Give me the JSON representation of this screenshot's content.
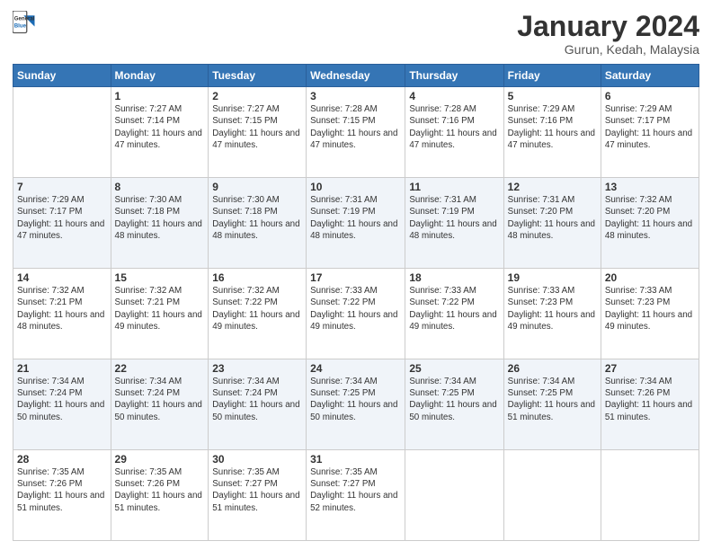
{
  "header": {
    "logo": {
      "general": "General",
      "blue": "Blue"
    },
    "title": "January 2024",
    "location": "Gurun, Kedah, Malaysia"
  },
  "columns": [
    "Sunday",
    "Monday",
    "Tuesday",
    "Wednesday",
    "Thursday",
    "Friday",
    "Saturday"
  ],
  "weeks": [
    [
      {
        "day": "",
        "sunrise": "",
        "sunset": "",
        "daylight": ""
      },
      {
        "day": "1",
        "sunrise": "Sunrise: 7:27 AM",
        "sunset": "Sunset: 7:14 PM",
        "daylight": "Daylight: 11 hours and 47 minutes."
      },
      {
        "day": "2",
        "sunrise": "Sunrise: 7:27 AM",
        "sunset": "Sunset: 7:15 PM",
        "daylight": "Daylight: 11 hours and 47 minutes."
      },
      {
        "day": "3",
        "sunrise": "Sunrise: 7:28 AM",
        "sunset": "Sunset: 7:15 PM",
        "daylight": "Daylight: 11 hours and 47 minutes."
      },
      {
        "day": "4",
        "sunrise": "Sunrise: 7:28 AM",
        "sunset": "Sunset: 7:16 PM",
        "daylight": "Daylight: 11 hours and 47 minutes."
      },
      {
        "day": "5",
        "sunrise": "Sunrise: 7:29 AM",
        "sunset": "Sunset: 7:16 PM",
        "daylight": "Daylight: 11 hours and 47 minutes."
      },
      {
        "day": "6",
        "sunrise": "Sunrise: 7:29 AM",
        "sunset": "Sunset: 7:17 PM",
        "daylight": "Daylight: 11 hours and 47 minutes."
      }
    ],
    [
      {
        "day": "7",
        "sunrise": "Sunrise: 7:29 AM",
        "sunset": "Sunset: 7:17 PM",
        "daylight": "Daylight: 11 hours and 47 minutes."
      },
      {
        "day": "8",
        "sunrise": "Sunrise: 7:30 AM",
        "sunset": "Sunset: 7:18 PM",
        "daylight": "Daylight: 11 hours and 48 minutes."
      },
      {
        "day": "9",
        "sunrise": "Sunrise: 7:30 AM",
        "sunset": "Sunset: 7:18 PM",
        "daylight": "Daylight: 11 hours and 48 minutes."
      },
      {
        "day": "10",
        "sunrise": "Sunrise: 7:31 AM",
        "sunset": "Sunset: 7:19 PM",
        "daylight": "Daylight: 11 hours and 48 minutes."
      },
      {
        "day": "11",
        "sunrise": "Sunrise: 7:31 AM",
        "sunset": "Sunset: 7:19 PM",
        "daylight": "Daylight: 11 hours and 48 minutes."
      },
      {
        "day": "12",
        "sunrise": "Sunrise: 7:31 AM",
        "sunset": "Sunset: 7:20 PM",
        "daylight": "Daylight: 11 hours and 48 minutes."
      },
      {
        "day": "13",
        "sunrise": "Sunrise: 7:32 AM",
        "sunset": "Sunset: 7:20 PM",
        "daylight": "Daylight: 11 hours and 48 minutes."
      }
    ],
    [
      {
        "day": "14",
        "sunrise": "Sunrise: 7:32 AM",
        "sunset": "Sunset: 7:21 PM",
        "daylight": "Daylight: 11 hours and 48 minutes."
      },
      {
        "day": "15",
        "sunrise": "Sunrise: 7:32 AM",
        "sunset": "Sunset: 7:21 PM",
        "daylight": "Daylight: 11 hours and 49 minutes."
      },
      {
        "day": "16",
        "sunrise": "Sunrise: 7:32 AM",
        "sunset": "Sunset: 7:22 PM",
        "daylight": "Daylight: 11 hours and 49 minutes."
      },
      {
        "day": "17",
        "sunrise": "Sunrise: 7:33 AM",
        "sunset": "Sunset: 7:22 PM",
        "daylight": "Daylight: 11 hours and 49 minutes."
      },
      {
        "day": "18",
        "sunrise": "Sunrise: 7:33 AM",
        "sunset": "Sunset: 7:22 PM",
        "daylight": "Daylight: 11 hours and 49 minutes."
      },
      {
        "day": "19",
        "sunrise": "Sunrise: 7:33 AM",
        "sunset": "Sunset: 7:23 PM",
        "daylight": "Daylight: 11 hours and 49 minutes."
      },
      {
        "day": "20",
        "sunrise": "Sunrise: 7:33 AM",
        "sunset": "Sunset: 7:23 PM",
        "daylight": "Daylight: 11 hours and 49 minutes."
      }
    ],
    [
      {
        "day": "21",
        "sunrise": "Sunrise: 7:34 AM",
        "sunset": "Sunset: 7:24 PM",
        "daylight": "Daylight: 11 hours and 50 minutes."
      },
      {
        "day": "22",
        "sunrise": "Sunrise: 7:34 AM",
        "sunset": "Sunset: 7:24 PM",
        "daylight": "Daylight: 11 hours and 50 minutes."
      },
      {
        "day": "23",
        "sunrise": "Sunrise: 7:34 AM",
        "sunset": "Sunset: 7:24 PM",
        "daylight": "Daylight: 11 hours and 50 minutes."
      },
      {
        "day": "24",
        "sunrise": "Sunrise: 7:34 AM",
        "sunset": "Sunset: 7:25 PM",
        "daylight": "Daylight: 11 hours and 50 minutes."
      },
      {
        "day": "25",
        "sunrise": "Sunrise: 7:34 AM",
        "sunset": "Sunset: 7:25 PM",
        "daylight": "Daylight: 11 hours and 50 minutes."
      },
      {
        "day": "26",
        "sunrise": "Sunrise: 7:34 AM",
        "sunset": "Sunset: 7:25 PM",
        "daylight": "Daylight: 11 hours and 51 minutes."
      },
      {
        "day": "27",
        "sunrise": "Sunrise: 7:34 AM",
        "sunset": "Sunset: 7:26 PM",
        "daylight": "Daylight: 11 hours and 51 minutes."
      }
    ],
    [
      {
        "day": "28",
        "sunrise": "Sunrise: 7:35 AM",
        "sunset": "Sunset: 7:26 PM",
        "daylight": "Daylight: 11 hours and 51 minutes."
      },
      {
        "day": "29",
        "sunrise": "Sunrise: 7:35 AM",
        "sunset": "Sunset: 7:26 PM",
        "daylight": "Daylight: 11 hours and 51 minutes."
      },
      {
        "day": "30",
        "sunrise": "Sunrise: 7:35 AM",
        "sunset": "Sunset: 7:27 PM",
        "daylight": "Daylight: 11 hours and 51 minutes."
      },
      {
        "day": "31",
        "sunrise": "Sunrise: 7:35 AM",
        "sunset": "Sunset: 7:27 PM",
        "daylight": "Daylight: 11 hours and 52 minutes."
      },
      {
        "day": "",
        "sunrise": "",
        "sunset": "",
        "daylight": ""
      },
      {
        "day": "",
        "sunrise": "",
        "sunset": "",
        "daylight": ""
      },
      {
        "day": "",
        "sunrise": "",
        "sunset": "",
        "daylight": ""
      }
    ]
  ]
}
